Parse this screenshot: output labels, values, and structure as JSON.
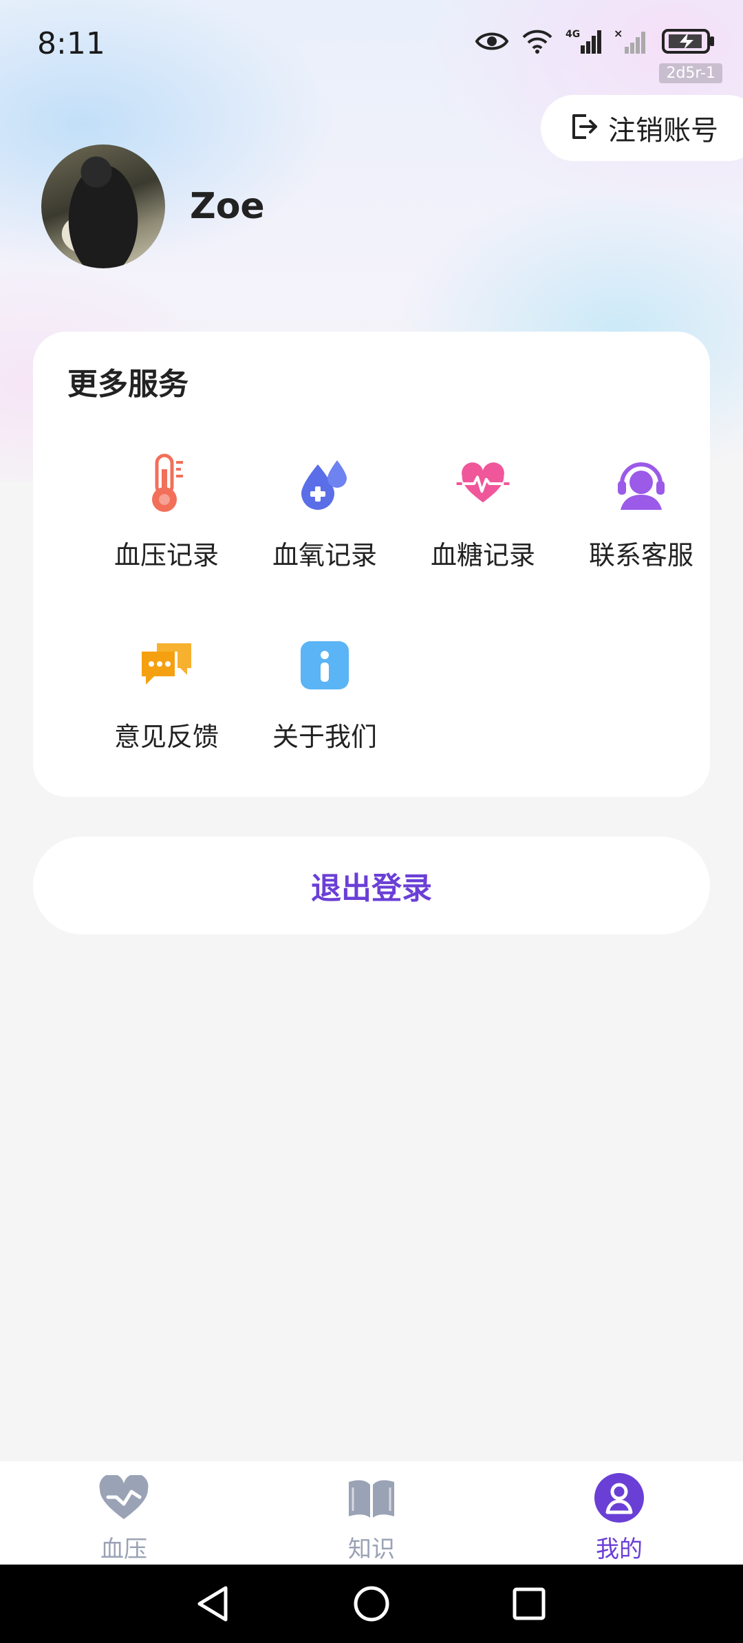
{
  "status_bar": {
    "time": "8:11",
    "build_tag": "2d5r-1",
    "icons": [
      "eye-icon",
      "wifi-icon",
      "signal-4g-icon",
      "signal-no-sim-icon",
      "battery-charging-icon"
    ]
  },
  "header": {
    "cancel_account_label": "注销账号",
    "username": "Zoe"
  },
  "services": {
    "title": "更多服务",
    "items": [
      {
        "label": "血压记录",
        "icon": "thermometer-icon",
        "color": "#f26f5a"
      },
      {
        "label": "血氧记录",
        "icon": "water-drop-icon",
        "color": "#5a6ee8"
      },
      {
        "label": "血糖记录",
        "icon": "heart-pulse-icon",
        "color": "#f0569a"
      },
      {
        "label": "联系客服",
        "icon": "headset-icon",
        "color": "#9b5ae8"
      },
      {
        "label": "意见反馈",
        "icon": "chat-bubble-icon",
        "color": "#f5a011"
      },
      {
        "label": "关于我们",
        "icon": "info-icon",
        "color": "#5ab4f5"
      }
    ]
  },
  "logout_label": "退出登录",
  "bottom_nav": {
    "items": [
      {
        "label": "血压",
        "icon": "heart-icon",
        "active": false
      },
      {
        "label": "知识",
        "icon": "book-icon",
        "active": false
      },
      {
        "label": "我的",
        "icon": "profile-icon",
        "active": true
      }
    ]
  },
  "colors": {
    "accent": "#6a3fd6",
    "nav_inactive": "#9aa2b5"
  }
}
